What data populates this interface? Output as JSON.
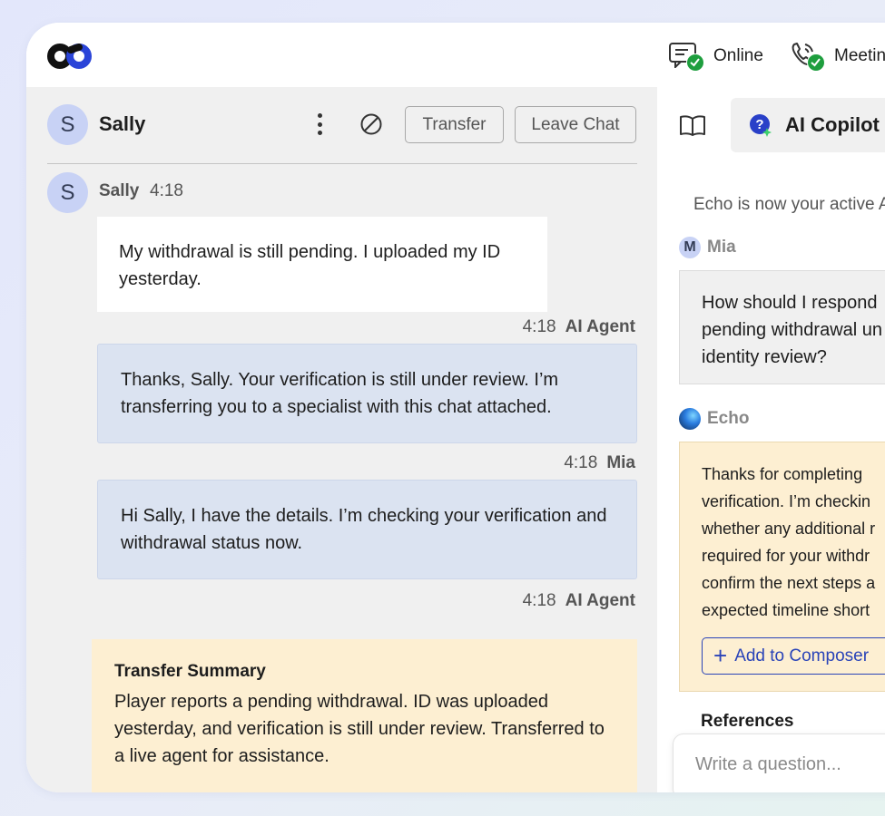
{
  "colors": {
    "accent": "#2a44b8",
    "online_green": "#1e9e3e",
    "ai_bubble": "#dbe3f1",
    "summary_bg": "#fdefd2"
  },
  "topbar": {
    "logo_icon": "infinity-logo",
    "statuses": [
      {
        "label": "Online",
        "icon": "chat-status-icon"
      },
      {
        "label": "Meetin",
        "icon": "phone-status-icon"
      }
    ]
  },
  "chat": {
    "contact": {
      "initial": "S",
      "name": "Sally"
    },
    "actions": {
      "more_icon": "kebab-menu-icon",
      "block_icon": "block-icon",
      "transfer": "Transfer",
      "leave": "Leave Chat"
    },
    "messages": [
      {
        "sender": "Sally",
        "time": "4:18",
        "text": "My withdrawal is still pending. I uploaded my ID yesterday."
      },
      {
        "sender": "AI Agent",
        "time": "4:18",
        "text": "Thanks, Sally. Your verification is still under review. I’m transferring you to a specialist with this chat attached."
      },
      {
        "sender": "Mia",
        "time": "4:18",
        "text": "Hi Sally, I have the details. I’m checking your verification and withdrawal status now."
      },
      {
        "sender": "AI Agent",
        "time": "4:18"
      }
    ],
    "summary": {
      "title": "Transfer Summary",
      "text": "Player reports a pending withdrawal. ID was uploaded yesterday, and verification is still under review. Transferred to a live agent for assistance."
    }
  },
  "copilot": {
    "tab_label": "AI Copilot",
    "notice": "Echo is now your active AI",
    "question": {
      "initial": "M",
      "sender": "Mia",
      "lines": [
        "How should I respond",
        "pending withdrawal un",
        "identity review?"
      ]
    },
    "answer": {
      "sender": "Echo",
      "lines": [
        "Thanks for completing",
        "verification. I’m checkin",
        "whether any additional r",
        "required for your withdr",
        "confirm the next steps a",
        "expected timeline short"
      ],
      "button": "Add to Composer"
    },
    "references_label": "References",
    "composer_placeholder": "Write a question..."
  }
}
